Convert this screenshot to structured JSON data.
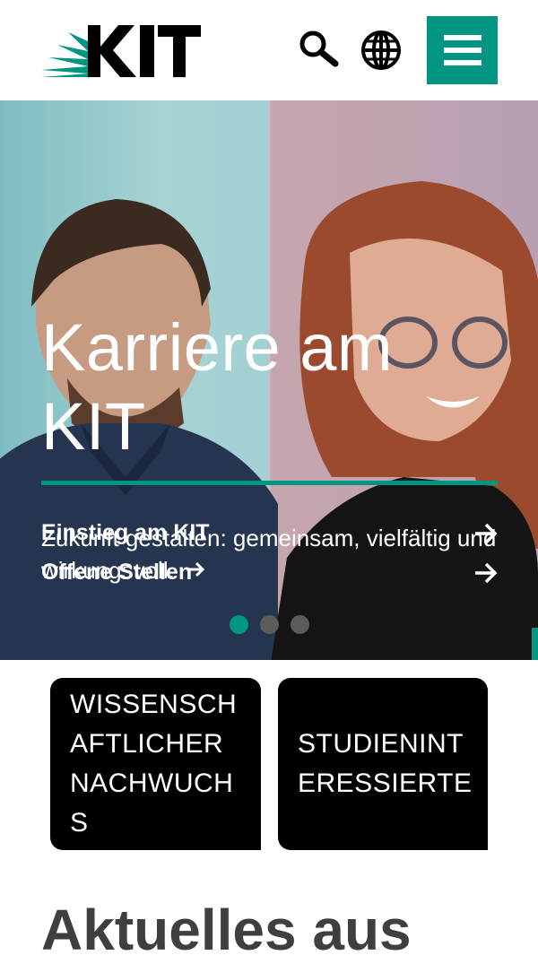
{
  "header": {
    "logo_text": "KIT",
    "icons": [
      "search-icon",
      "globe-icon",
      "hamburger-menu-icon"
    ],
    "accent_color": "#009682"
  },
  "hero": {
    "title": "Karriere am KIT",
    "subtitle": "Zukunft gestalten: gemeinsam, vielfältig und wirkungsvoll.",
    "links": [
      {
        "label": "Einstieg am KIT"
      },
      {
        "label": "Offene Stellen"
      }
    ],
    "slides": {
      "count": 3,
      "active": 1
    }
  },
  "tiles": [
    {
      "label": "WISSENSCHAFTLICHER NACHWUCHS"
    },
    {
      "label": "STUDIENINTERESSIERTE"
    }
  ],
  "news": {
    "heading": "Aktuelles aus"
  }
}
